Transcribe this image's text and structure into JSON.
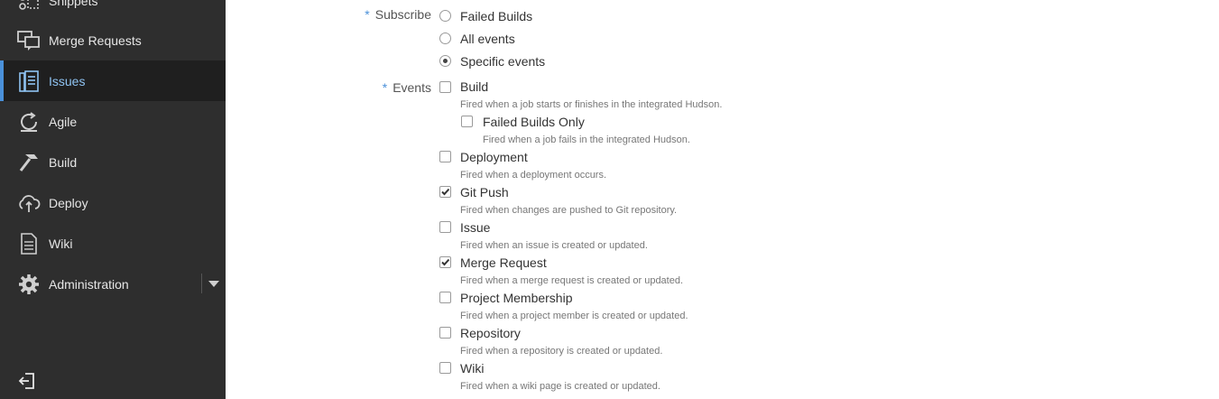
{
  "sidebar": {
    "items": [
      {
        "label": "Snippets",
        "icon": "snippets-icon"
      },
      {
        "label": "Merge Requests",
        "icon": "merge-requests-icon"
      },
      {
        "label": "Issues",
        "icon": "issues-icon",
        "active": true
      },
      {
        "label": "Agile",
        "icon": "agile-icon"
      },
      {
        "label": "Build",
        "icon": "build-hammer-icon"
      },
      {
        "label": "Deploy",
        "icon": "deploy-cloud-icon"
      },
      {
        "label": "Wiki",
        "icon": "wiki-document-icon"
      },
      {
        "label": "Administration",
        "icon": "gear-icon"
      }
    ],
    "colors": {
      "background": "#2e2e2e",
      "active_background": "#1f1f1f",
      "active_text": "#8fc3f2",
      "accent": "#4a90d9"
    }
  },
  "form": {
    "required_marker": "*",
    "subscribe": {
      "label": "Subscribe",
      "options": [
        {
          "label": "Failed Builds",
          "checked": false
        },
        {
          "label": "All events",
          "checked": false
        },
        {
          "label": "Specific events",
          "checked": true
        }
      ]
    },
    "events": {
      "label": "Events",
      "options": [
        {
          "label": "Build",
          "desc": "Fired when a job starts or finishes in the integrated Hudson.",
          "checked": false
        },
        {
          "label": "Failed Builds Only",
          "desc": "Fired when a job fails in the integrated Hudson.",
          "checked": false
        },
        {
          "label": "Deployment",
          "desc": "Fired when a deployment occurs.",
          "checked": false
        },
        {
          "label": "Git Push",
          "desc": "Fired when changes are pushed to Git repository.",
          "checked": true
        },
        {
          "label": "Issue",
          "desc": "Fired when an issue is created or updated.",
          "checked": false
        },
        {
          "label": "Merge Request",
          "desc": "Fired when a merge request is created or updated.",
          "checked": true
        },
        {
          "label": "Project Membership",
          "desc": "Fired when a project member is created or updated.",
          "checked": false
        },
        {
          "label": "Repository",
          "desc": "Fired when a repository is created or updated.",
          "checked": false
        },
        {
          "label": "Wiki",
          "desc": "Fired when a wiki page is created or updated.",
          "checked": false
        }
      ]
    }
  }
}
